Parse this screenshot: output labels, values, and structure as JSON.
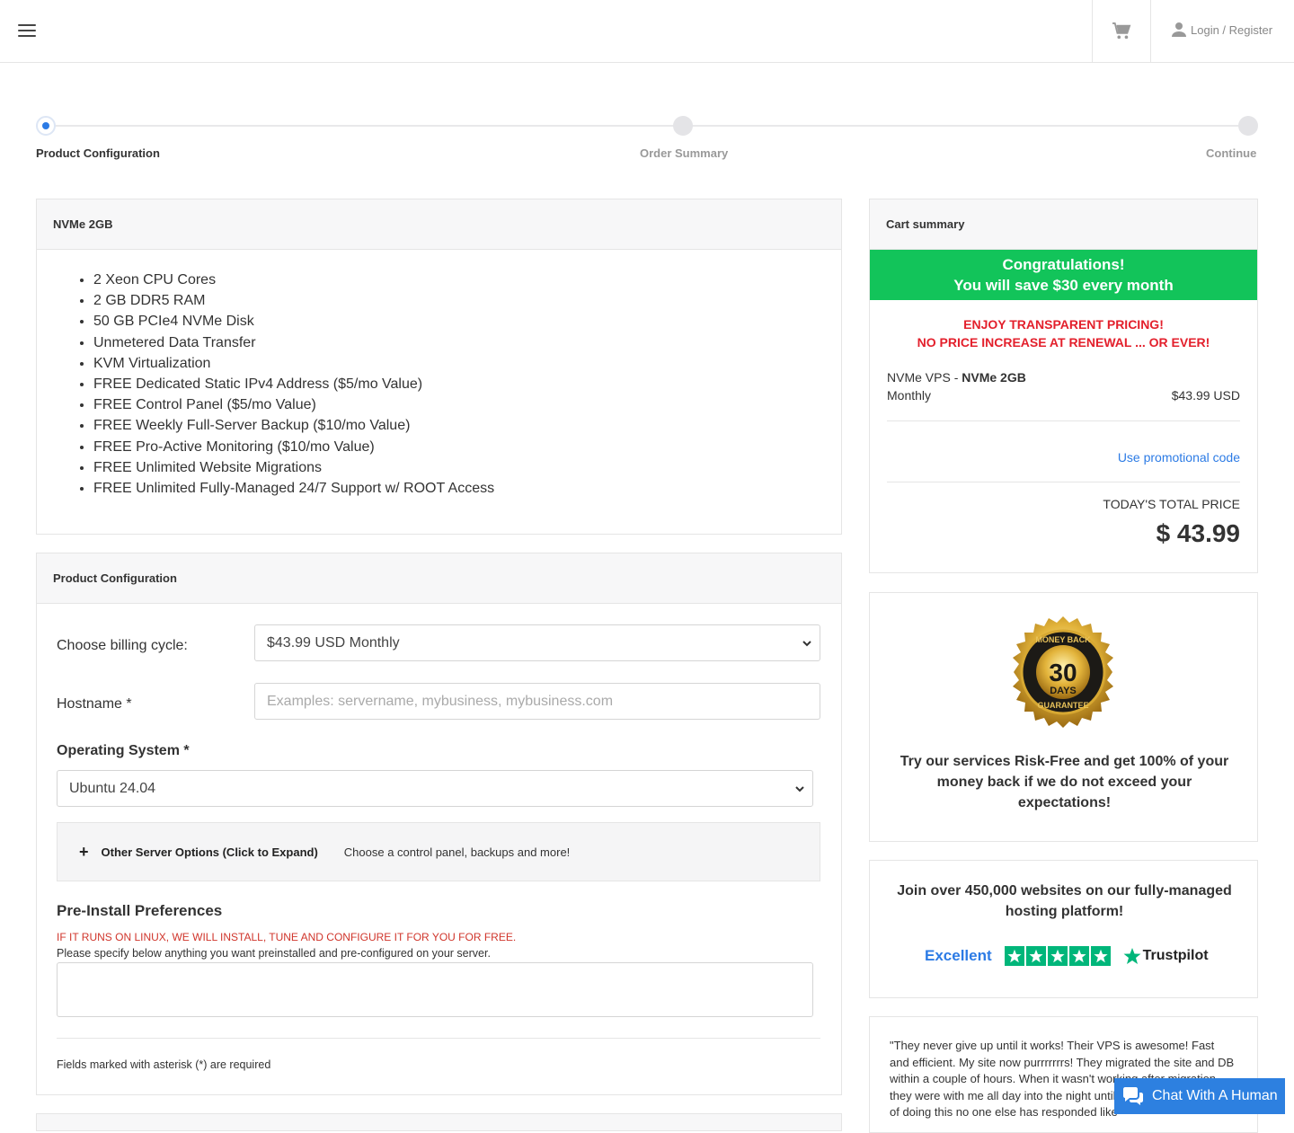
{
  "header": {
    "login_label": "Login / Register"
  },
  "steps": [
    {
      "label": "Product Configuration"
    },
    {
      "label": "Order Summary"
    },
    {
      "label": "Continue"
    }
  ],
  "product": {
    "title": "NVMe 2GB",
    "features": [
      "2 Xeon CPU Cores",
      "2 GB DDR5 RAM",
      "50 GB PCIe4 NVMe Disk",
      "Unmetered Data Transfer",
      "KVM Virtualization",
      "FREE Dedicated Static IPv4 Address ($5/mo Value)",
      "FREE Control Panel ($5/mo Value)",
      "FREE Weekly Full-Server Backup ($10/mo Value)",
      "FREE Pro-Active Monitoring ($10/mo Value)",
      "FREE Unlimited Website Migrations",
      "FREE Unlimited Fully-Managed 24/7 Support w/ ROOT Access"
    ]
  },
  "config": {
    "title": "Product Configuration",
    "billing_label": "Choose billing cycle:",
    "billing_value": "$43.99 USD Monthly",
    "hostname_label": "Hostname *",
    "hostname_placeholder": "Examples: servername, mybusiness, mybusiness.com",
    "os_label": "Operating System *",
    "os_value": "Ubuntu 24.04",
    "expand_label": "Other Server Options (Click to Expand)",
    "expand_desc": "Choose a control panel, backups and more!",
    "preinstall_title": "Pre-Install Preferences",
    "preinstall_red": "IF IT RUNS ON LINUX, WE WILL INSTALL, TUNE AND CONFIGURE IT FOR YOU FOR FREE.",
    "preinstall_note": "Please specify below anything you want preinstalled and pre-configured on your server.",
    "required_note": "Fields marked with asterisk (*) are required"
  },
  "cart": {
    "title": "Cart summary",
    "congrats_line1": "Congratulations!",
    "congrats_line2": "You will save $30 every month",
    "red_line1": "ENJOY TRANSPARENT PRICING!",
    "red_line2": "NO PRICE INCREASE AT RENEWAL ... OR EVER!",
    "product_group": "NVMe VPS - ",
    "product_name": "NVMe 2GB",
    "cycle": "Monthly",
    "price": "$43.99 USD",
    "promo_link": "Use promotional code",
    "total_label": "TODAY'S TOTAL PRICE",
    "total_value": "$ 43.99"
  },
  "guarantee": {
    "badge_top": "MONEY BACK",
    "badge_num": "30",
    "badge_days": "DAYS",
    "badge_bottom": "GUARANTEE",
    "text": "Try our services Risk-Free and get 100% of your money back if we do not exceed your expectations!"
  },
  "trust": {
    "text": "Join over 450,000 websites on our fully-managed hosting platform!",
    "rating_word": "Excellent",
    "brand": "Trustpilot",
    "stars": 5,
    "star_color": "#00b67a"
  },
  "testimonial": {
    "text": "\"They never give up until it works! Their VPS is awesome! Fast and efficient. My site now purrrrrrrs! They migrated the site and DB within a couple of hours. When it wasn't working after migration they were with me all day into the night until it worked. In 15 years of doing this no one else has responded like"
  },
  "chat": {
    "label": "Chat With A Human"
  },
  "colors": {
    "accent": "#2c7be5",
    "green": "#12c45a",
    "red": "#e3202c",
    "chat": "#2d80e0"
  }
}
